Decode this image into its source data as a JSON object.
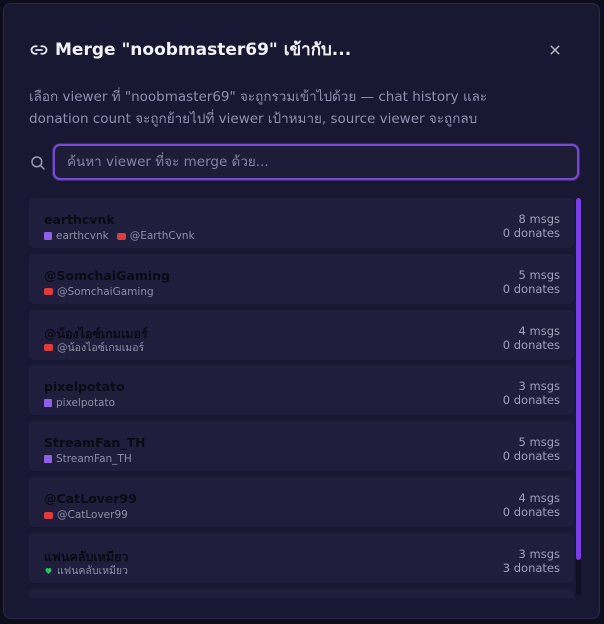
{
  "dialog": {
    "title": "Merge \"noobmaster69\" เข้ากับ...",
    "description": "เลือก viewer ที่ \"noobmaster69\" จะถูกรวมเข้าไปด้วย — chat history และ donation count จะถูกย้ายไปที่ viewer เป้าหมาย, source viewer จะถูกลบ"
  },
  "search": {
    "placeholder": "ค้นหา viewer ที่จะ merge ด้วย...",
    "value": ""
  },
  "viewers": [
    {
      "name": "earthcvnk",
      "accounts": [
        {
          "platform": "twitch",
          "handle": "earthcvnk"
        },
        {
          "platform": "youtube",
          "handle": "@EarthCvnk"
        }
      ],
      "msgs": "8 msgs",
      "donates": "0 donates"
    },
    {
      "name": "@SomchaiGaming",
      "accounts": [
        {
          "platform": "youtube",
          "handle": "@SomchaiGaming"
        }
      ],
      "msgs": "5 msgs",
      "donates": "0 donates"
    },
    {
      "name": "@น้องไอซ์เกมเมอร์",
      "accounts": [
        {
          "platform": "youtube",
          "handle": "@น้องไอซ์เกมเมอร์"
        }
      ],
      "msgs": "4 msgs",
      "donates": "0 donates"
    },
    {
      "name": "pixelpotato",
      "accounts": [
        {
          "platform": "twitch",
          "handle": "pixelpotato"
        }
      ],
      "msgs": "3 msgs",
      "donates": "0 donates"
    },
    {
      "name": "StreamFan_TH",
      "accounts": [
        {
          "platform": "twitch",
          "handle": "StreamFan_TH"
        }
      ],
      "msgs": "5 msgs",
      "donates": "0 donates"
    },
    {
      "name": "@CatLover99",
      "accounts": [
        {
          "platform": "youtube",
          "handle": "@CatLover99"
        }
      ],
      "msgs": "4 msgs",
      "donates": "0 donates"
    },
    {
      "name": "แฟนคลับเหมียว",
      "accounts": [
        {
          "platform": "heart",
          "handle": "แฟนคลับเหมียว"
        }
      ],
      "msgs": "3 msgs",
      "donates": "3 donates"
    },
    {
      "name": "",
      "accounts": [],
      "msgs": "",
      "donates": ""
    }
  ],
  "colors": {
    "accent": "#7b3ee6",
    "twitch": "#8f5de8",
    "youtube": "#e03a3a",
    "heart": "#22c55e"
  },
  "icons": {
    "title": "link-icon",
    "close": "close-icon",
    "search": "search-icon"
  }
}
